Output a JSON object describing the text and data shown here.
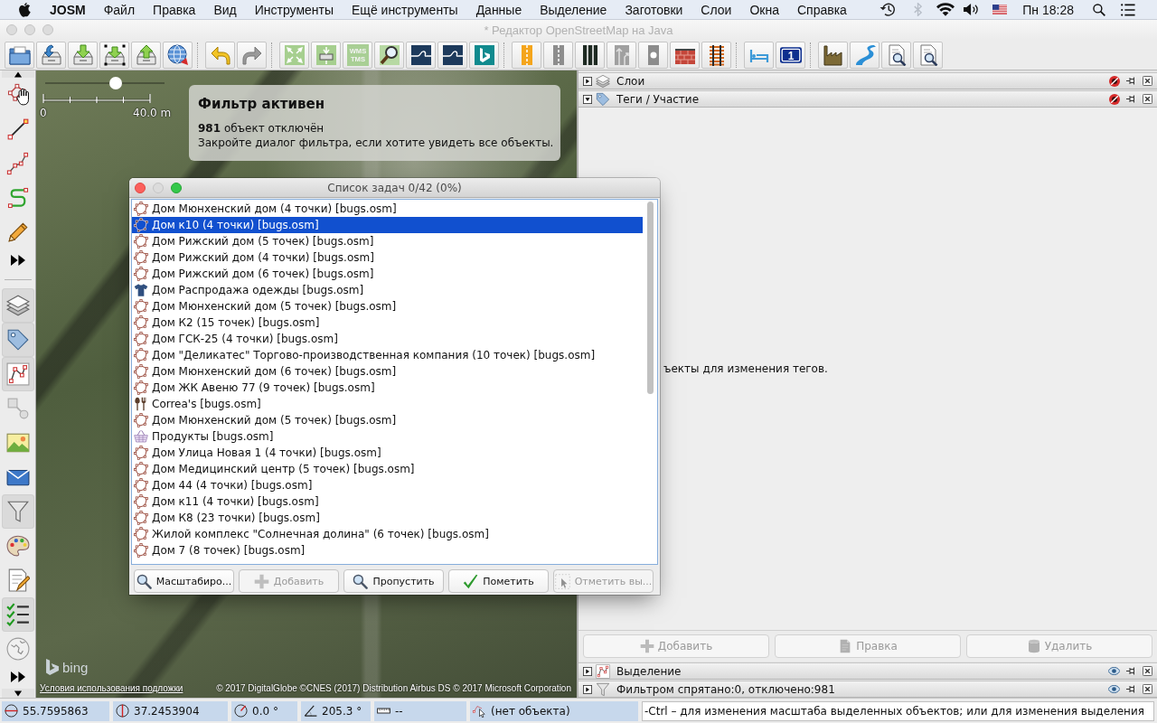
{
  "menu_bar": {
    "app_name": "JOSM",
    "items": [
      "Файл",
      "Правка",
      "Вид",
      "Инструменты",
      "Ещё инструменты",
      "Данные",
      "Выделение",
      "Заготовки",
      "Слои",
      "Окна",
      "Справка"
    ],
    "clock": "Пн 18:28"
  },
  "window": {
    "title": "* Редактор OpenStreetMap на Java"
  },
  "toolbar": {
    "tile_badge": [
      "WMS",
      "TMS"
    ],
    "number_badge": "1"
  },
  "side_toolbar": {
    "dialog_toggles": [
      {
        "kind": "layers",
        "selected": true
      },
      {
        "kind": "tags",
        "selected": true
      },
      {
        "kind": "selection",
        "selected": true
      },
      {
        "kind": "relations",
        "selected": false
      },
      {
        "kind": "images",
        "selected": false
      },
      {
        "kind": "conflicts",
        "selected": false
      },
      {
        "kind": "filter",
        "selected": true
      },
      {
        "kind": "styles",
        "selected": false
      },
      {
        "kind": "validator",
        "selected": false
      },
      {
        "kind": "todo",
        "selected": true
      },
      {
        "kind": "wiki",
        "selected": false
      }
    ]
  },
  "map": {
    "zoom_slider": {
      "level": 0.6
    },
    "scale": {
      "start": "0",
      "end": "40.0 m"
    },
    "filter_notice": {
      "title": "Фильтр активен",
      "lines": [
        "**981** объект отключён",
        "Закройте диалог фильтра, если хотите увидеть все объекты."
      ]
    },
    "logo_text": "bing",
    "terms_link": "Условия использования подложки",
    "attribution": "© 2017 DigitalGlobe ©CNES (2017) Distribution Airbus DS © 2017 Microsoft Corporation"
  },
  "todo_dialog": {
    "title": "Список задач 0/42 (0%)",
    "items": [
      {
        "kind": "building",
        "text": "Дом Мюнхенский дом (4 точки) [bugs.osm]",
        "selected": false
      },
      {
        "kind": "building",
        "text": "Дом к10 (4 точки) [bugs.osm]",
        "selected": true
      },
      {
        "kind": "building",
        "text": "Дом Рижский дом (5 точек) [bugs.osm]",
        "selected": false
      },
      {
        "kind": "building",
        "text": "Дом Рижский дом (4 точки) [bugs.osm]",
        "selected": false
      },
      {
        "kind": "building",
        "text": "Дом Рижский дом (6 точек) [bugs.osm]",
        "selected": false
      },
      {
        "kind": "clothes",
        "text": "Дом Распродажа одежды [bugs.osm]",
        "selected": false
      },
      {
        "kind": "building",
        "text": "Дом Мюнхенский дом (5 точек) [bugs.osm]",
        "selected": false
      },
      {
        "kind": "building",
        "text": "Дом К2 (15 точек) [bugs.osm]",
        "selected": false
      },
      {
        "kind": "building",
        "text": "Дом ГСК-25 (4 точки) [bugs.osm]",
        "selected": false
      },
      {
        "kind": "building",
        "text": "Дом \"Деликатес\" Торгово-производственная компания (10 точек) [bugs.osm]",
        "selected": false
      },
      {
        "kind": "building",
        "text": "Дом Мюнхенский дом (6 точек) [bugs.osm]",
        "selected": false
      },
      {
        "kind": "building",
        "text": "Дом ЖК Авеню 77 (9 точек) [bugs.osm]",
        "selected": false
      },
      {
        "kind": "restaurant",
        "text": "Correa's [bugs.osm]",
        "selected": false
      },
      {
        "kind": "building",
        "text": "Дом Мюнхенский дом (5 точек) [bugs.osm]",
        "selected": false
      },
      {
        "kind": "shop",
        "text": "Продукты [bugs.osm]",
        "selected": false
      },
      {
        "kind": "building",
        "text": "Дом Улица Новая 1 (4 точки) [bugs.osm]",
        "selected": false
      },
      {
        "kind": "building",
        "text": "Дом Медицинский центр (5 точек) [bugs.osm]",
        "selected": false
      },
      {
        "kind": "building",
        "text": "Дом 44 (4 точки) [bugs.osm]",
        "selected": false
      },
      {
        "kind": "building",
        "text": "Дом к11 (4 точки) [bugs.osm]",
        "selected": false
      },
      {
        "kind": "building",
        "text": "Дом К8 (23 точки) [bugs.osm]",
        "selected": false
      },
      {
        "kind": "building",
        "text": "Жилой комплекс \"Солнечная долина\" (6 точек) [bugs.osm]",
        "selected": false
      },
      {
        "kind": "building",
        "text": "Дом 7 (8 точек) [bugs.osm]",
        "selected": false
      }
    ],
    "buttons": [
      {
        "kind": "zoom",
        "label": "Масштабиро...",
        "disabled": false
      },
      {
        "kind": "add",
        "label": "Добавить",
        "disabled": true
      },
      {
        "kind": "skip",
        "label": "Пропустить",
        "disabled": false
      },
      {
        "kind": "mark",
        "label": "Пометить",
        "disabled": false
      },
      {
        "kind": "select",
        "label": "Отметить вы...",
        "disabled": true
      }
    ]
  },
  "right_panel": {
    "dialogs": [
      {
        "kind": "layers",
        "title": "Слои",
        "expanded": false,
        "show_buttons": false
      },
      {
        "kind": "tags",
        "title": "Теги / Участие",
        "expanded": true,
        "show_buttons": false,
        "hint": "ъекты для изменения тегов.",
        "buttons": [
          {
            "kind": "add",
            "label": "Добавить",
            "disabled": true
          },
          {
            "kind": "edit",
            "label": "Правка",
            "disabled": true
          },
          {
            "kind": "delete",
            "label": "Удалить",
            "disabled": true
          }
        ]
      },
      {
        "kind": "selection",
        "title": "Выделение",
        "expanded": false,
        "show_buttons": true
      },
      {
        "kind": "filter",
        "title": "Фильтром спрятано:0, отключено:981",
        "expanded": false,
        "show_buttons": true
      }
    ]
  },
  "status_bar": {
    "fields": [
      {
        "kind": "latitude",
        "text": "55.7595863"
      },
      {
        "kind": "longitude",
        "text": "37.2453904"
      },
      {
        "kind": "heading",
        "text": "0.0 °"
      },
      {
        "kind": "angle",
        "text": "205.3 °"
      },
      {
        "kind": "distance",
        "text": "--"
      },
      {
        "kind": "object",
        "text": "(нет объекта)"
      }
    ],
    "help": "-Ctrl – для изменения масштаба выделенных объектов; или для изменения выделения"
  }
}
